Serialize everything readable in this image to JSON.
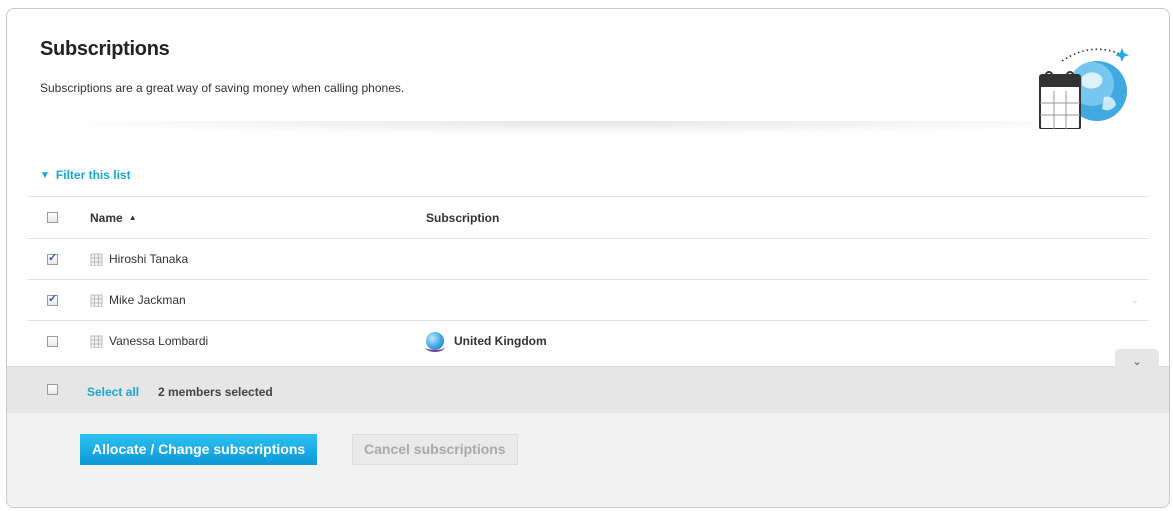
{
  "header": {
    "title": "Subscriptions",
    "subtitle": "Subscriptions are a great way of saving money when calling phones."
  },
  "filter": {
    "label": "Filter this list"
  },
  "table": {
    "columns": {
      "name": "Name",
      "subscription": "Subscription"
    },
    "sort": {
      "column": "name",
      "direction": "ascending"
    },
    "rows": [
      {
        "name": "Hiroshi Tanaka",
        "subscription": "",
        "checked": true
      },
      {
        "name": "Mike Jackman",
        "subscription": "",
        "checked": true
      },
      {
        "name": "Vanessa Lombardi",
        "subscription": "United Kingdom",
        "checked": false
      }
    ]
  },
  "selection": {
    "select_all_label": "Select all",
    "selected_text": "2 members selected"
  },
  "actions": {
    "allocate_label": "Allocate / Change subscriptions",
    "cancel_label": "Cancel subscriptions"
  },
  "colors": {
    "accent": "#1aa6d6",
    "primary_button": "#0d98d6",
    "select_bar": "#e6e6e6"
  },
  "icons": {
    "header": "calendar-globe-icon",
    "member": "building-icon",
    "subscription": "globe-icon",
    "filter": "chevron-down-icon",
    "sort": "sort-ascending-icon"
  }
}
